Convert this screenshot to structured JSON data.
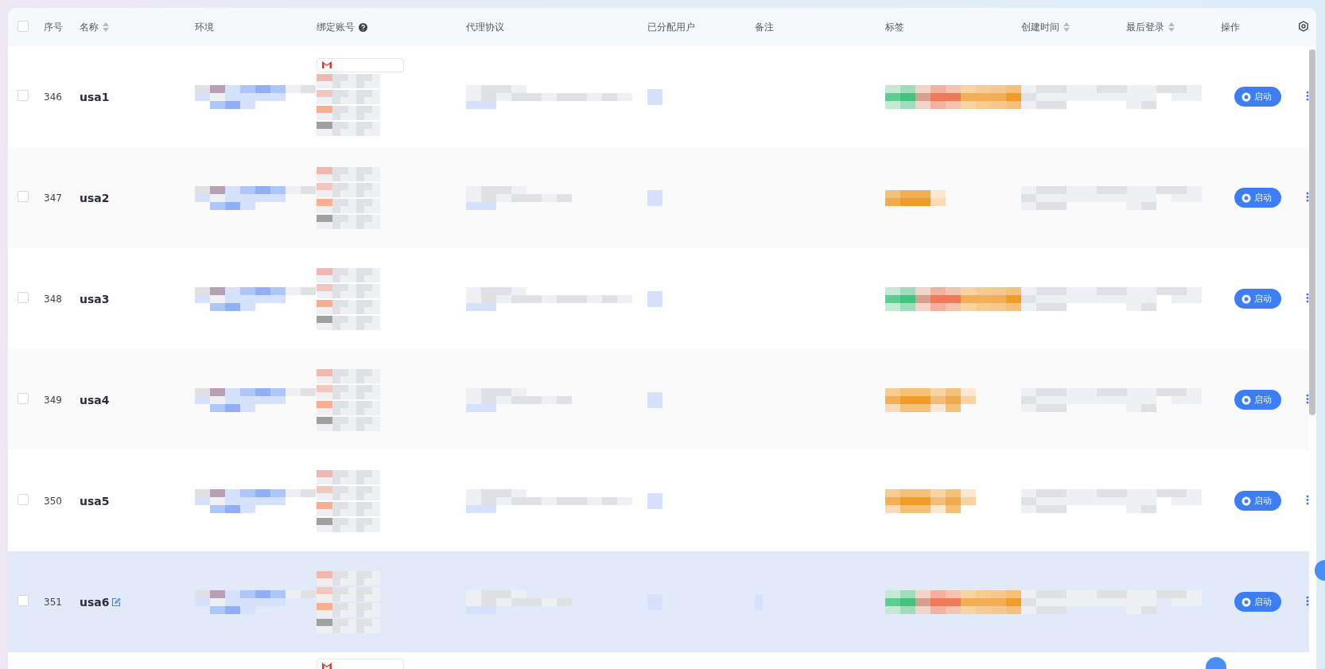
{
  "table": {
    "header_checkbox": {
      "checked": false
    },
    "columns": [
      {
        "label": "序号",
        "sortable": false,
        "help": false
      },
      {
        "label": "名称",
        "sortable": true,
        "help": false
      },
      {
        "label": "环境",
        "sortable": false,
        "help": false
      },
      {
        "label": "绑定账号",
        "sortable": false,
        "help": true
      },
      {
        "label": "代理协议",
        "sortable": false,
        "help": false
      },
      {
        "label": "已分配用户",
        "sortable": false,
        "help": false
      },
      {
        "label": "备注",
        "sortable": false,
        "help": false
      },
      {
        "label": "标签",
        "sortable": false,
        "help": false
      },
      {
        "label": "创建时间",
        "sortable": true,
        "help": false
      },
      {
        "label": "最后登录",
        "sortable": true,
        "help": false
      },
      {
        "label": "操作",
        "sortable": false,
        "help": false
      }
    ],
    "rows": [
      {
        "index": "346",
        "name": "usa1",
        "checked": false,
        "hovered": false,
        "action": "启动"
      },
      {
        "index": "347",
        "name": "usa2",
        "checked": false,
        "hovered": false,
        "action": "启动"
      },
      {
        "index": "348",
        "name": "usa3",
        "checked": false,
        "hovered": false,
        "action": "启动"
      },
      {
        "index": "349",
        "name": "usa4",
        "checked": false,
        "hovered": false,
        "action": "启动"
      },
      {
        "index": "350",
        "name": "usa5",
        "checked": false,
        "hovered": false,
        "action": "启动"
      },
      {
        "index": "351",
        "name": "usa6",
        "checked": false,
        "hovered": true,
        "action": "启动"
      }
    ]
  }
}
